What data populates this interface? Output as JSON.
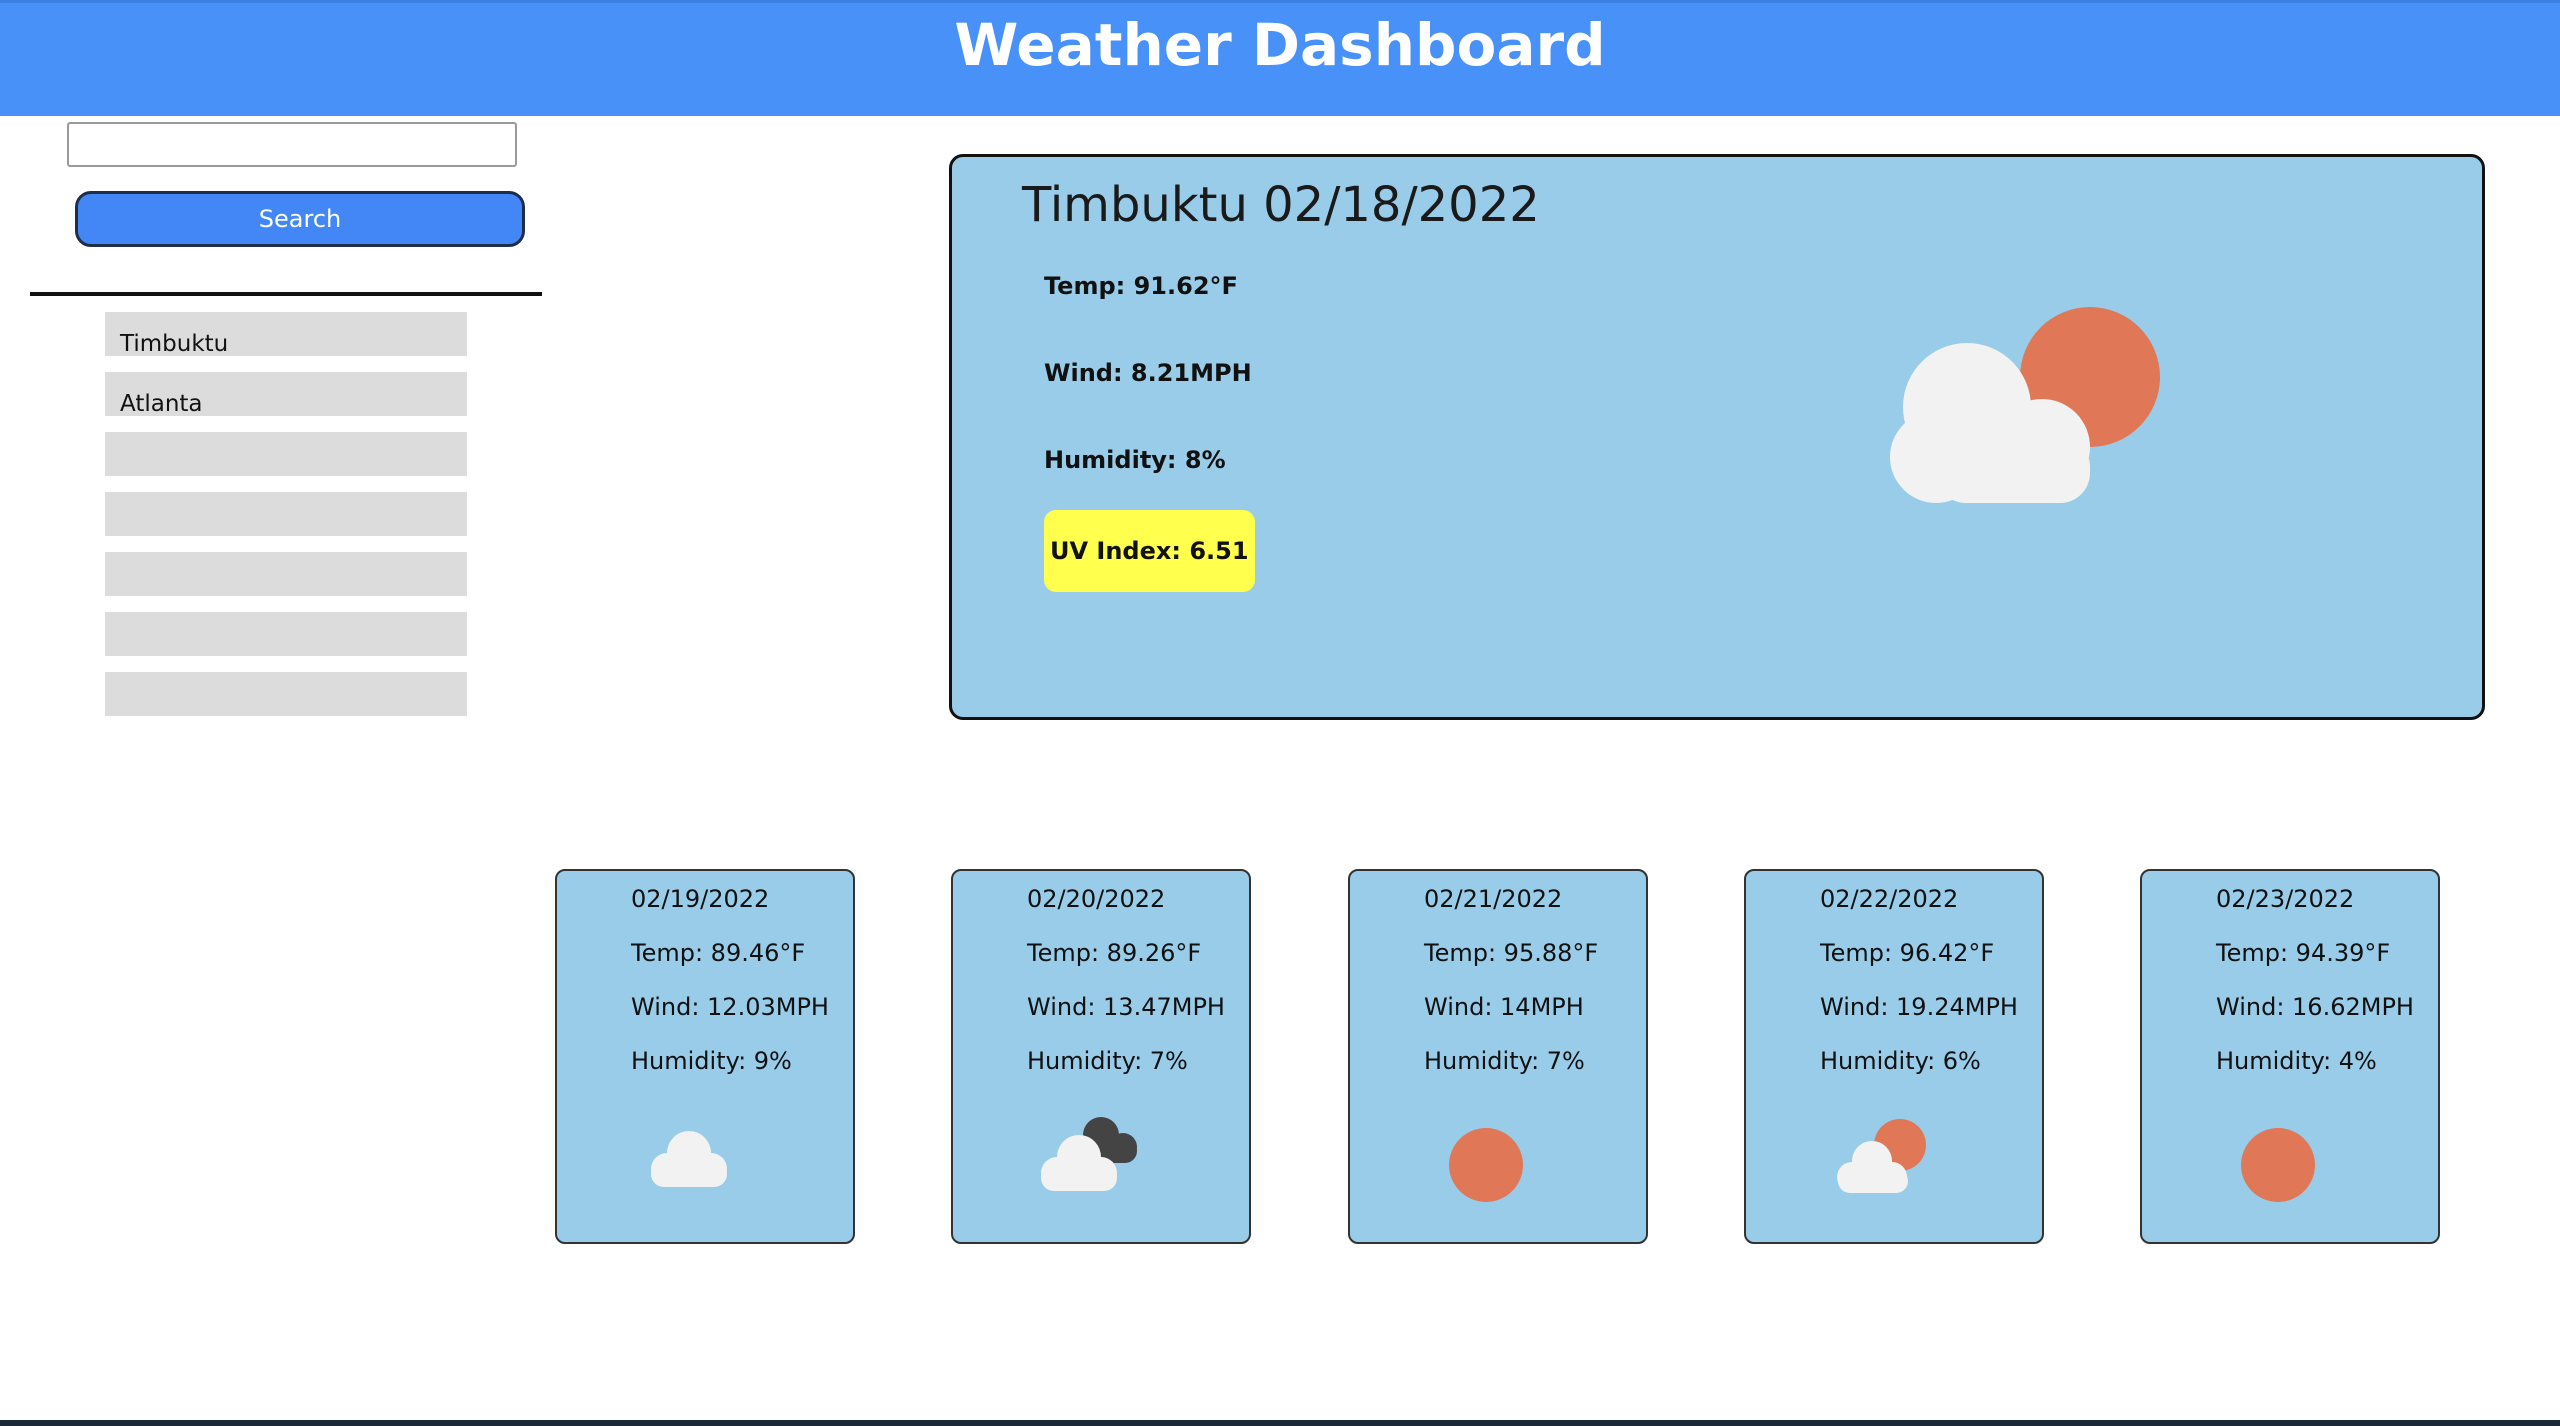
{
  "header": {
    "title": "Weather Dashboard"
  },
  "search": {
    "placeholder": "",
    "value": "",
    "button_label": "Search"
  },
  "history": [
    "Timbuktu",
    "Atlanta",
    "",
    "",
    "",
    "",
    ""
  ],
  "current": {
    "title": "Timbuktu 02/18/2022",
    "temp": "Temp: 91.62°F",
    "wind": "Wind: 8.21MPH",
    "humidity": "Humidity: 8%",
    "uv": "UV Index: 6.51",
    "icon": "partly-cloudy-day-icon"
  },
  "forecast": [
    {
      "date": "02/19/2022",
      "temp": "Temp: 89.46°F",
      "wind": "Wind: 12.03MPH",
      "humidity": "Humidity: 9%",
      "icon": "cloud-icon"
    },
    {
      "date": "02/20/2022",
      "temp": "Temp: 89.26°F",
      "wind": "Wind: 13.47MPH",
      "humidity": "Humidity: 7%",
      "icon": "broken-clouds-icon"
    },
    {
      "date": "02/21/2022",
      "temp": "Temp: 95.88°F",
      "wind": "Wind: 14MPH",
      "humidity": "Humidity: 7%",
      "icon": "sun-icon"
    },
    {
      "date": "02/22/2022",
      "temp": "Temp: 96.42°F",
      "wind": "Wind: 19.24MPH",
      "humidity": "Humidity: 6%",
      "icon": "partly-cloudy-day-icon"
    },
    {
      "date": "02/23/2022",
      "temp": "Temp: 94.39°F",
      "wind": "Wind: 16.62MPH",
      "humidity": "Humidity: 4%",
      "icon": "sun-icon"
    }
  ],
  "colors": {
    "header": "#4891f8",
    "card": "#99cce9",
    "uv_moderate": "#ffff4d",
    "sun": "#e07757",
    "cloud": "#f2f2f2",
    "dark_cloud": "#444444"
  }
}
